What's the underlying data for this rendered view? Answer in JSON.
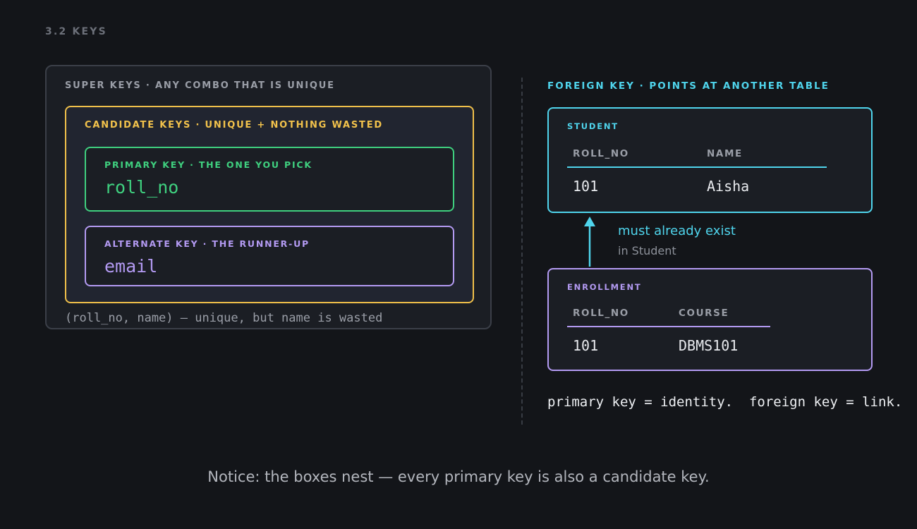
{
  "section": "3.2  KEYS",
  "super_keys": {
    "title": "SUPER KEYS  ·  ANY COMBO THAT IS UNIQUE",
    "note": "(roll_no, name)  — unique, but name is wasted"
  },
  "candidate_keys": {
    "title": "CANDIDATE KEYS  ·  UNIQUE + NOTHING WASTED"
  },
  "primary_key": {
    "title": "PRIMARY KEY  ·  THE ONE YOU PICK",
    "value": "roll_no"
  },
  "alternate_key": {
    "title": "ALTERNATE KEY  ·  THE RUNNER-UP",
    "value": "email"
  },
  "foreign_key": {
    "title": "FOREIGN KEY  ·  POINTS AT ANOTHER TABLE",
    "link_label": "must already exist",
    "link_sub": "in Student"
  },
  "student_table": {
    "name": "STUDENT",
    "columns": [
      "ROLL_NO",
      "NAME"
    ],
    "rows": [
      [
        "101",
        "Aisha"
      ]
    ]
  },
  "enrollment_table": {
    "name": "ENROLLMENT",
    "columns": [
      "ROLL_NO",
      "COURSE"
    ],
    "rows": [
      [
        "101",
        "DBMS101"
      ]
    ]
  },
  "summary": "primary key = identity.  foreign key = link.",
  "caption": "Notice: the boxes nest — every primary key is also a candidate key.",
  "colors": {
    "background": "#131519",
    "super": "#3b3f48",
    "candidate": "#f0c04a",
    "primary": "#3fd07f",
    "alternate": "#b39af2",
    "foreign": "#4fd4ec"
  }
}
